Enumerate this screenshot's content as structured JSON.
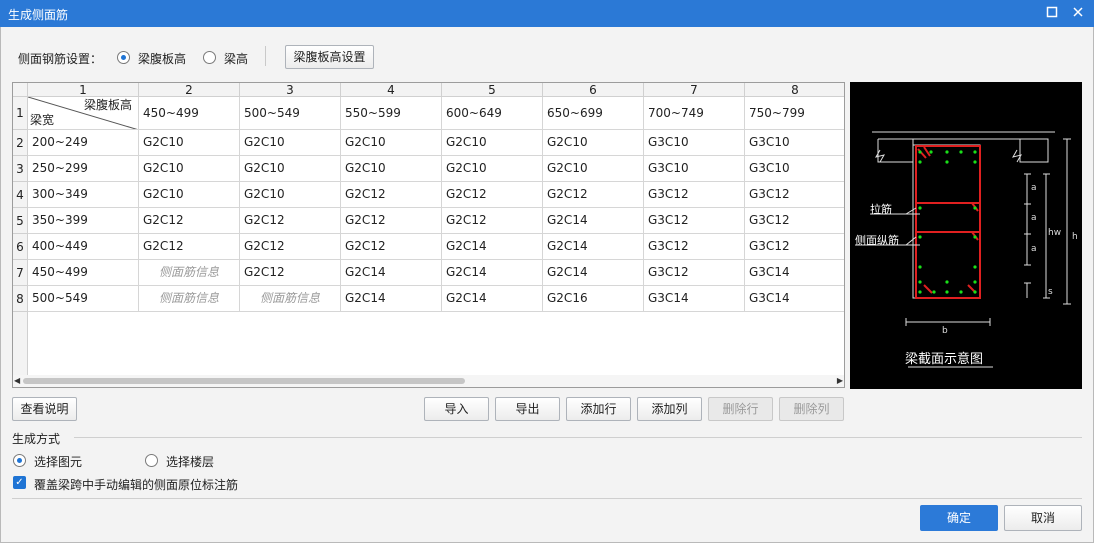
{
  "window": {
    "title": "生成侧面筋",
    "maximize_icon": "maximize-icon",
    "close_icon": "close-icon"
  },
  "settings": {
    "label": "侧面钢筋设置：",
    "option_web": "梁腹板高",
    "option_height": "梁高",
    "selected": "梁腹板高",
    "config_button": "梁腹板高设置"
  },
  "grid": {
    "col_numbers": [
      "1",
      "2",
      "3",
      "4",
      "5",
      "6",
      "7",
      "8"
    ],
    "row_numbers": [
      "1",
      "2",
      "3",
      "4",
      "5",
      "6",
      "7",
      "8"
    ],
    "corner_top": "梁腹板高",
    "corner_bottom": "梁宽",
    "header": [
      "450~499",
      "500~549",
      "550~599",
      "600~649",
      "650~699",
      "700~749",
      "750~799"
    ],
    "rows": [
      {
        "width": "200~249",
        "cells": [
          "G2C10",
          "G2C10",
          "G2C10",
          "G2C10",
          "G2C10",
          "G3C10",
          "G3C10"
        ]
      },
      {
        "width": "250~299",
        "cells": [
          "G2C10",
          "G2C10",
          "G2C10",
          "G2C10",
          "G2C10",
          "G3C10",
          "G3C10"
        ]
      },
      {
        "width": "300~349",
        "cells": [
          "G2C10",
          "G2C10",
          "G2C12",
          "G2C12",
          "G2C12",
          "G3C12",
          "G3C12"
        ]
      },
      {
        "width": "350~399",
        "cells": [
          "G2C12",
          "G2C12",
          "G2C12",
          "G2C12",
          "G2C14",
          "G3C12",
          "G3C12"
        ]
      },
      {
        "width": "400~449",
        "cells": [
          "G2C12",
          "G2C12",
          "G2C12",
          "G2C14",
          "G2C14",
          "G3C12",
          "G3C12"
        ]
      },
      {
        "width": "450~499",
        "cells": [
          "侧面筋信息",
          "G2C12",
          "G2C14",
          "G2C14",
          "G2C14",
          "G3C12",
          "G3C14"
        ]
      },
      {
        "width": "500~549",
        "cells": [
          "侧面筋信息",
          "侧面筋信息",
          "G2C14",
          "G2C14",
          "G2C16",
          "G3C14",
          "G3C14"
        ]
      }
    ],
    "placeholder_text": "侧面筋信息"
  },
  "diagram": {
    "label_tie": "拉筋",
    "label_side": "侧面纵筋",
    "caption": "梁截面示意图",
    "dim_a": "a",
    "dim_hw": "hw",
    "dim_h": "h",
    "dim_s": "s",
    "dim_b": "b"
  },
  "toolbar": {
    "help": "查看说明",
    "import": "导入",
    "export": "导出",
    "add_row": "添加行",
    "add_col": "添加列",
    "del_row": "删除行",
    "del_col": "删除列"
  },
  "generate": {
    "title": "生成方式",
    "option_element": "选择图元",
    "option_floor": "选择楼层",
    "selected": "选择图元",
    "override_label": "覆盖梁跨中手动编辑的侧面原位标注筋",
    "override_checked": true
  },
  "footer": {
    "ok": "确定",
    "cancel": "取消"
  },
  "colors": {
    "accent": "#2b79d6",
    "rebar_red": "#e02020",
    "rebar_green": "#19e019"
  }
}
